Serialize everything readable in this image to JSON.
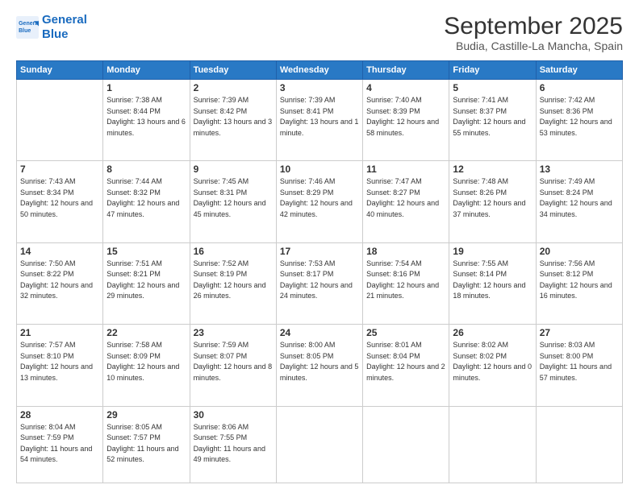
{
  "logo": {
    "line1": "General",
    "line2": "Blue"
  },
  "title": "September 2025",
  "location": "Budia, Castille-La Mancha, Spain",
  "weekdays": [
    "Sunday",
    "Monday",
    "Tuesday",
    "Wednesday",
    "Thursday",
    "Friday",
    "Saturday"
  ],
  "weeks": [
    [
      {
        "day": "",
        "sunrise": "",
        "sunset": "",
        "daylight": ""
      },
      {
        "day": "1",
        "sunrise": "Sunrise: 7:38 AM",
        "sunset": "Sunset: 8:44 PM",
        "daylight": "Daylight: 13 hours and 6 minutes."
      },
      {
        "day": "2",
        "sunrise": "Sunrise: 7:39 AM",
        "sunset": "Sunset: 8:42 PM",
        "daylight": "Daylight: 13 hours and 3 minutes."
      },
      {
        "day": "3",
        "sunrise": "Sunrise: 7:39 AM",
        "sunset": "Sunset: 8:41 PM",
        "daylight": "Daylight: 13 hours and 1 minute."
      },
      {
        "day": "4",
        "sunrise": "Sunrise: 7:40 AM",
        "sunset": "Sunset: 8:39 PM",
        "daylight": "Daylight: 12 hours and 58 minutes."
      },
      {
        "day": "5",
        "sunrise": "Sunrise: 7:41 AM",
        "sunset": "Sunset: 8:37 PM",
        "daylight": "Daylight: 12 hours and 55 minutes."
      },
      {
        "day": "6",
        "sunrise": "Sunrise: 7:42 AM",
        "sunset": "Sunset: 8:36 PM",
        "daylight": "Daylight: 12 hours and 53 minutes."
      }
    ],
    [
      {
        "day": "7",
        "sunrise": "Sunrise: 7:43 AM",
        "sunset": "Sunset: 8:34 PM",
        "daylight": "Daylight: 12 hours and 50 minutes."
      },
      {
        "day": "8",
        "sunrise": "Sunrise: 7:44 AM",
        "sunset": "Sunset: 8:32 PM",
        "daylight": "Daylight: 12 hours and 47 minutes."
      },
      {
        "day": "9",
        "sunrise": "Sunrise: 7:45 AM",
        "sunset": "Sunset: 8:31 PM",
        "daylight": "Daylight: 12 hours and 45 minutes."
      },
      {
        "day": "10",
        "sunrise": "Sunrise: 7:46 AM",
        "sunset": "Sunset: 8:29 PM",
        "daylight": "Daylight: 12 hours and 42 minutes."
      },
      {
        "day": "11",
        "sunrise": "Sunrise: 7:47 AM",
        "sunset": "Sunset: 8:27 PM",
        "daylight": "Daylight: 12 hours and 40 minutes."
      },
      {
        "day": "12",
        "sunrise": "Sunrise: 7:48 AM",
        "sunset": "Sunset: 8:26 PM",
        "daylight": "Daylight: 12 hours and 37 minutes."
      },
      {
        "day": "13",
        "sunrise": "Sunrise: 7:49 AM",
        "sunset": "Sunset: 8:24 PM",
        "daylight": "Daylight: 12 hours and 34 minutes."
      }
    ],
    [
      {
        "day": "14",
        "sunrise": "Sunrise: 7:50 AM",
        "sunset": "Sunset: 8:22 PM",
        "daylight": "Daylight: 12 hours and 32 minutes."
      },
      {
        "day": "15",
        "sunrise": "Sunrise: 7:51 AM",
        "sunset": "Sunset: 8:21 PM",
        "daylight": "Daylight: 12 hours and 29 minutes."
      },
      {
        "day": "16",
        "sunrise": "Sunrise: 7:52 AM",
        "sunset": "Sunset: 8:19 PM",
        "daylight": "Daylight: 12 hours and 26 minutes."
      },
      {
        "day": "17",
        "sunrise": "Sunrise: 7:53 AM",
        "sunset": "Sunset: 8:17 PM",
        "daylight": "Daylight: 12 hours and 24 minutes."
      },
      {
        "day": "18",
        "sunrise": "Sunrise: 7:54 AM",
        "sunset": "Sunset: 8:16 PM",
        "daylight": "Daylight: 12 hours and 21 minutes."
      },
      {
        "day": "19",
        "sunrise": "Sunrise: 7:55 AM",
        "sunset": "Sunset: 8:14 PM",
        "daylight": "Daylight: 12 hours and 18 minutes."
      },
      {
        "day": "20",
        "sunrise": "Sunrise: 7:56 AM",
        "sunset": "Sunset: 8:12 PM",
        "daylight": "Daylight: 12 hours and 16 minutes."
      }
    ],
    [
      {
        "day": "21",
        "sunrise": "Sunrise: 7:57 AM",
        "sunset": "Sunset: 8:10 PM",
        "daylight": "Daylight: 12 hours and 13 minutes."
      },
      {
        "day": "22",
        "sunrise": "Sunrise: 7:58 AM",
        "sunset": "Sunset: 8:09 PM",
        "daylight": "Daylight: 12 hours and 10 minutes."
      },
      {
        "day": "23",
        "sunrise": "Sunrise: 7:59 AM",
        "sunset": "Sunset: 8:07 PM",
        "daylight": "Daylight: 12 hours and 8 minutes."
      },
      {
        "day": "24",
        "sunrise": "Sunrise: 8:00 AM",
        "sunset": "Sunset: 8:05 PM",
        "daylight": "Daylight: 12 hours and 5 minutes."
      },
      {
        "day": "25",
        "sunrise": "Sunrise: 8:01 AM",
        "sunset": "Sunset: 8:04 PM",
        "daylight": "Daylight: 12 hours and 2 minutes."
      },
      {
        "day": "26",
        "sunrise": "Sunrise: 8:02 AM",
        "sunset": "Sunset: 8:02 PM",
        "daylight": "Daylight: 12 hours and 0 minutes."
      },
      {
        "day": "27",
        "sunrise": "Sunrise: 8:03 AM",
        "sunset": "Sunset: 8:00 PM",
        "daylight": "Daylight: 11 hours and 57 minutes."
      }
    ],
    [
      {
        "day": "28",
        "sunrise": "Sunrise: 8:04 AM",
        "sunset": "Sunset: 7:59 PM",
        "daylight": "Daylight: 11 hours and 54 minutes."
      },
      {
        "day": "29",
        "sunrise": "Sunrise: 8:05 AM",
        "sunset": "Sunset: 7:57 PM",
        "daylight": "Daylight: 11 hours and 52 minutes."
      },
      {
        "day": "30",
        "sunrise": "Sunrise: 8:06 AM",
        "sunset": "Sunset: 7:55 PM",
        "daylight": "Daylight: 11 hours and 49 minutes."
      },
      {
        "day": "",
        "sunrise": "",
        "sunset": "",
        "daylight": ""
      },
      {
        "day": "",
        "sunrise": "",
        "sunset": "",
        "daylight": ""
      },
      {
        "day": "",
        "sunrise": "",
        "sunset": "",
        "daylight": ""
      },
      {
        "day": "",
        "sunrise": "",
        "sunset": "",
        "daylight": ""
      }
    ]
  ]
}
